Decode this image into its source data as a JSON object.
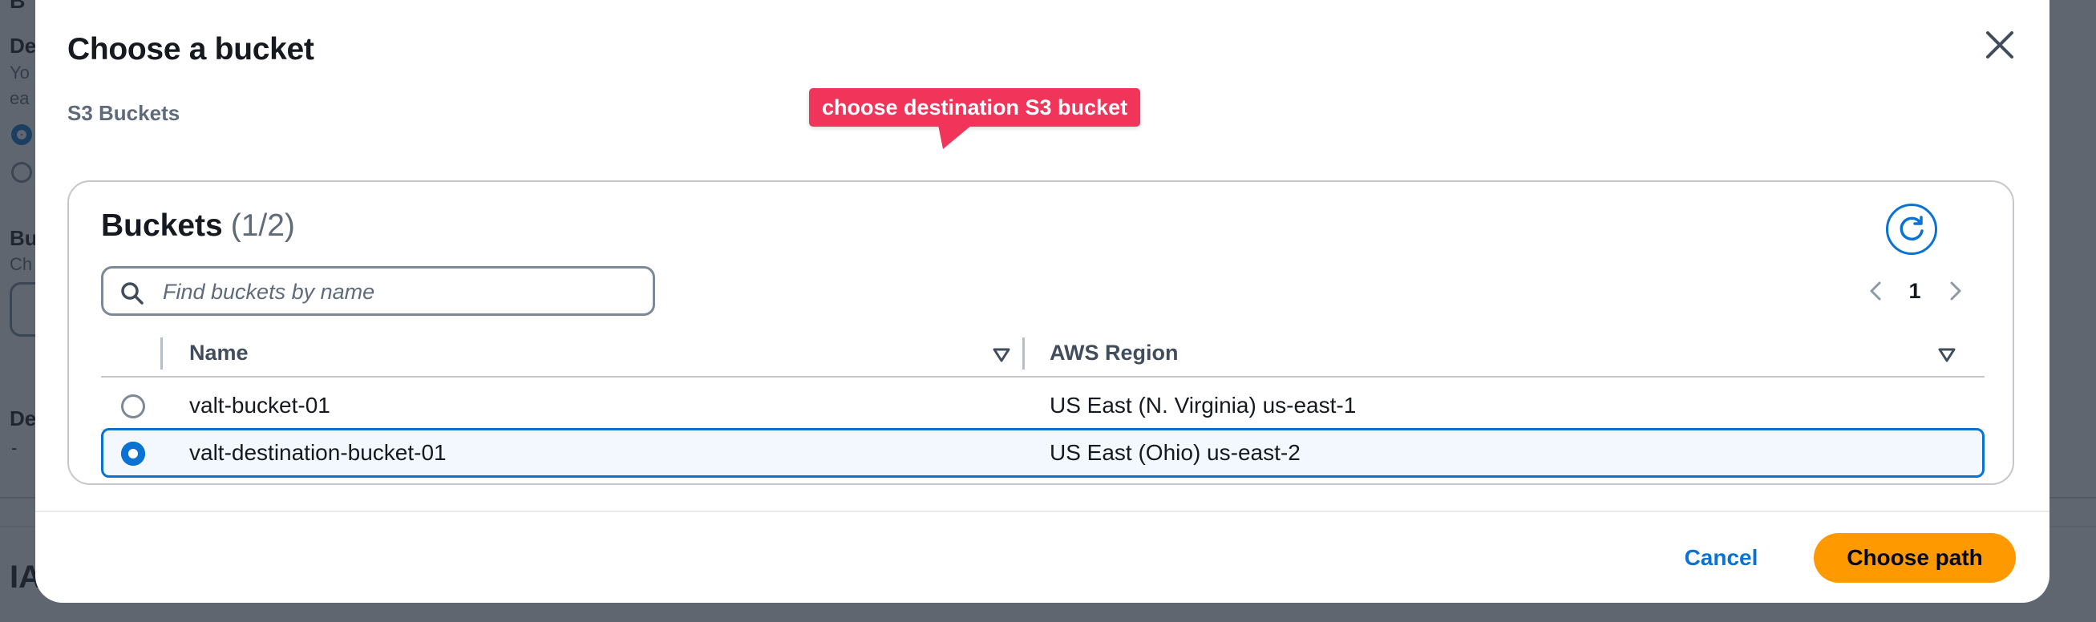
{
  "background": {
    "letters": [
      "B",
      "De",
      "Yo",
      "ea",
      "Bu",
      "Ch",
      "De",
      "-",
      "IA"
    ]
  },
  "modal": {
    "title": "Choose a bucket",
    "subtitle": "S3 Buckets",
    "close_icon": "close-icon"
  },
  "callout": {
    "text": "choose destination S3 bucket",
    "color": "#f0345a"
  },
  "buckets": {
    "title": "Buckets",
    "count": "(1/2)",
    "refresh_icon": "refresh-icon",
    "search": {
      "placeholder": "Find buckets by name",
      "value": "",
      "icon": "search-icon"
    },
    "pagination": {
      "prev_icon": "chevron-left-icon",
      "current_page": "1",
      "next_icon": "chevron-right-icon"
    },
    "columns": [
      {
        "label": "Name",
        "sort_icon": "sort-caret-down-icon"
      },
      {
        "label": "AWS Region",
        "sort_icon": "sort-caret-down-icon"
      }
    ],
    "rows": [
      {
        "name": "valt-bucket-01",
        "region": "US East (N. Virginia) us-east-1",
        "selected": false
      },
      {
        "name": "valt-destination-bucket-01",
        "region": "US East (Ohio) us-east-2",
        "selected": true
      }
    ]
  },
  "footer": {
    "cancel_label": "Cancel",
    "primary_label": "Choose path"
  },
  "colors": {
    "accent": "#0972d3",
    "primary_button": "#ff9900",
    "selected_row_bg": "#f2f8fd"
  }
}
